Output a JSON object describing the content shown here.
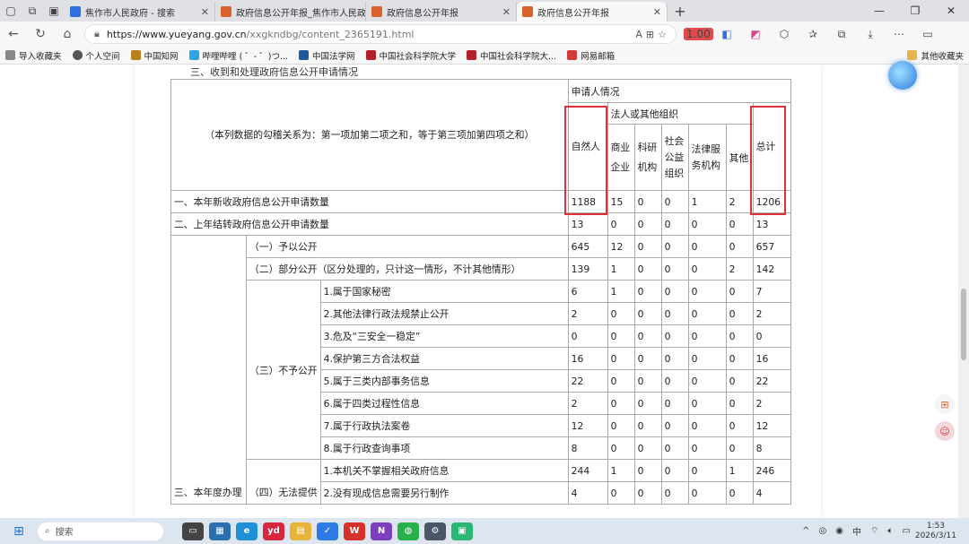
{
  "browser": {
    "tabs": [
      {
        "title": "焦作市人民政府 - 搜索",
        "color": "#2f6fde"
      },
      {
        "title": "政府信息公开年报_焦作市人民政府",
        "color": "#d9622a"
      },
      {
        "title": "政府信息公开年报",
        "color": "#d9622a"
      },
      {
        "title": "政府信息公开年报",
        "color": "#d9622a",
        "active": true
      }
    ],
    "url_host": "https://www.yueyang.gov.cn",
    "url_path": "/xxgkndbg/content_2365191.html",
    "extension_badge": "1.00"
  },
  "bookmarks": [
    {
      "label": "导入收藏夹",
      "color": "#666"
    },
    {
      "label": "个人空间",
      "color": "#555"
    },
    {
      "label": "中国知网",
      "color": "#b8801a"
    },
    {
      "label": "哔哩哔哩 ( ゜- ゜)つ...",
      "color": "#2fa3e3"
    },
    {
      "label": "中国法学网",
      "color": "#1f5a9c"
    },
    {
      "label": "中国社会科学院大学",
      "color": "#b2202a"
    },
    {
      "label": "中国社会科学院大...",
      "color": "#b2202a"
    },
    {
      "label": "网易邮箱",
      "color": "#d13b3b"
    }
  ],
  "bookmarks_other": "其他收藏夹",
  "page": {
    "section_title": "三、收到和处理政府信息公开申请情况",
    "header": {
      "note": "（本列数据的勾稽关系为：第一项加第二项之和，等于第三项加第四项之和）",
      "applicant": "申请人情况",
      "legal": "法人或其他组织",
      "cols": [
        "自然人",
        "商业企业",
        "科研机构",
        "社会公益组织",
        "法律服务机构",
        "其他",
        "总计"
      ]
    },
    "rows": [
      {
        "label": "一、本年新收政府信息公开申请数量",
        "values": [
          "1188",
          "15",
          "0",
          "0",
          "1",
          "2",
          "1206"
        ]
      },
      {
        "label": "二、上年结转政府信息公开申请数量",
        "values": [
          "13",
          "0",
          "0",
          "0",
          "0",
          "0",
          "13"
        ]
      }
    ],
    "third_label": "三、本年度办理",
    "groups": [
      {
        "label": "（一）予以公开",
        "values": [
          "645",
          "12",
          "0",
          "0",
          "0",
          "0",
          "657"
        ]
      },
      {
        "label": "（二）部分公开（区分处理的，只计这一情形，不计其他情形）",
        "values": [
          "139",
          "1",
          "0",
          "0",
          "0",
          "2",
          "142"
        ]
      }
    ],
    "deny_label": "（三）不予公开",
    "deny_rows": [
      {
        "label": "1.属于国家秘密",
        "values": [
          "6",
          "1",
          "0",
          "0",
          "0",
          "0",
          "7"
        ]
      },
      {
        "label": "2.其他法律行政法规禁止公开",
        "values": [
          "2",
          "0",
          "0",
          "0",
          "0",
          "0",
          "2"
        ]
      },
      {
        "label": "3.危及“三安全一稳定”",
        "values": [
          "0",
          "0",
          "0",
          "0",
          "0",
          "0",
          "0"
        ]
      },
      {
        "label": "4.保护第三方合法权益",
        "values": [
          "16",
          "0",
          "0",
          "0",
          "0",
          "0",
          "16"
        ]
      },
      {
        "label": "5.属于三类内部事务信息",
        "values": [
          "22",
          "0",
          "0",
          "0",
          "0",
          "0",
          "22"
        ]
      },
      {
        "label": "6.属于四类过程性信息",
        "values": [
          "2",
          "0",
          "0",
          "0",
          "0",
          "0",
          "2"
        ]
      },
      {
        "label": "7.属于行政执法案卷",
        "values": [
          "12",
          "0",
          "0",
          "0",
          "0",
          "0",
          "12"
        ]
      },
      {
        "label": "8.属于行政查询事项",
        "values": [
          "8",
          "0",
          "0",
          "0",
          "0",
          "0",
          "8"
        ]
      }
    ],
    "unable_label": "（四）无法提供",
    "unable_rows": [
      {
        "label": "1.本机关不掌握相关政府信息",
        "values": [
          "244",
          "1",
          "0",
          "0",
          "0",
          "1",
          "246"
        ]
      },
      {
        "label": "2.没有现成信息需要另行制作",
        "values": [
          "4",
          "0",
          "0",
          "0",
          "0",
          "0",
          "4"
        ]
      }
    ]
  },
  "taskbar": {
    "search_placeholder": "搜索",
    "ime": "中",
    "time": "1:53",
    "date": "2026/3/11"
  }
}
